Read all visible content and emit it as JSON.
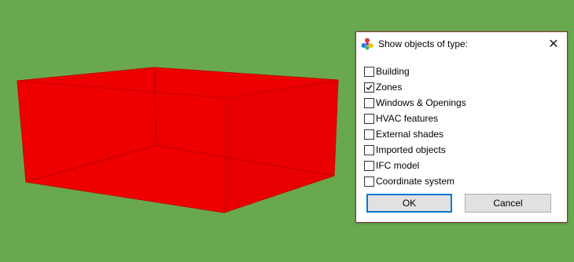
{
  "viewport": {
    "background_color": "#69a84f",
    "object_color": "#ef0000",
    "object_name": "zone-box"
  },
  "dialog": {
    "title": "Show objects of type:",
    "icon": "app-icon",
    "close_icon": "close-icon",
    "close_glyph": "✕",
    "items": [
      {
        "label": "Building",
        "checked": false
      },
      {
        "label": "Zones",
        "checked": true
      },
      {
        "label": "Windows & Openings",
        "checked": false
      },
      {
        "label": "HVAC features",
        "checked": false
      },
      {
        "label": "External shades",
        "checked": false
      },
      {
        "label": "Imported objects",
        "checked": false
      },
      {
        "label": "IFC model",
        "checked": false
      },
      {
        "label": "Coordinate system",
        "checked": false
      }
    ],
    "buttons": {
      "ok_label": "OK",
      "cancel_label": "Cancel"
    }
  }
}
